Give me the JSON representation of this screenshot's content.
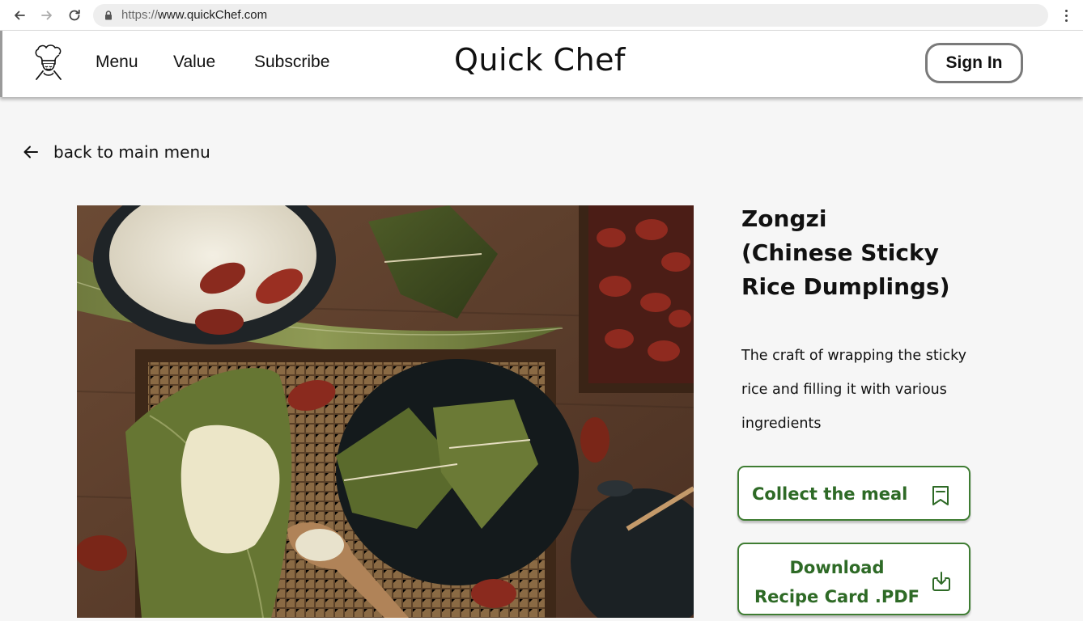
{
  "browser": {
    "url_scheme": "https://",
    "url_host": "www.quickChef.com"
  },
  "header": {
    "brand": "Quick Chef",
    "nav": [
      {
        "label": "Menu"
      },
      {
        "label": "Value"
      },
      {
        "label": "Subscribe"
      }
    ],
    "sign_in_label": "Sign In"
  },
  "back_link": {
    "label": "back to main menu"
  },
  "recipe": {
    "title_lines": [
      "Zongzi",
      "(Chinese Sticky",
      "Rice Dumplings)"
    ],
    "description_lines": [
      "The craft of wrapping the sticky",
      "rice and filling it with various",
      "ingredients"
    ],
    "collect_label": "Collect the meal",
    "download_label_lines": [
      "Download",
      "Recipe Card .PDF"
    ]
  },
  "colors": {
    "accent_green": "#2e6a26",
    "button_border": "#3f7d33",
    "page_background": "#f6f6f6"
  },
  "icons": [
    "back-arrow-icon",
    "forward-arrow-icon",
    "reload-icon",
    "lock-icon",
    "menu-kebab-icon",
    "chef-hat-logo-icon",
    "left-arrow-icon",
    "bookmark-icon",
    "download-icon"
  ]
}
